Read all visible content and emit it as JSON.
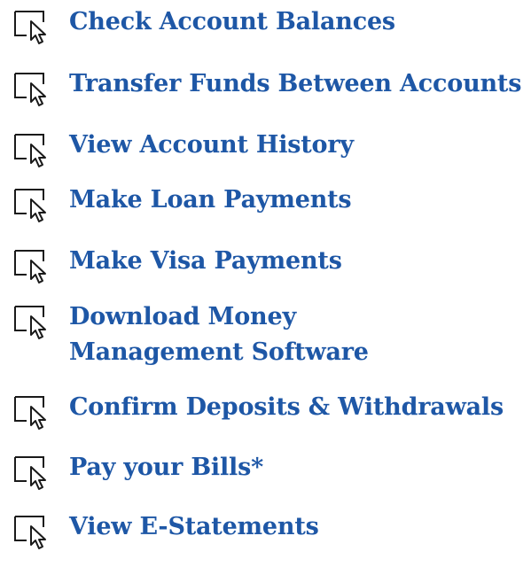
{
  "colors": {
    "link_text": "#1e57a6",
    "icon_stroke": "#1a1a1a",
    "background": "#ffffff"
  },
  "features": {
    "icon": "mouse-pointer-cursor-icon",
    "items": [
      {
        "label": "Check Account Balances"
      },
      {
        "label": "Transfer Funds Between Accounts"
      },
      {
        "label": "View Account History"
      },
      {
        "label": "Make Loan Payments"
      },
      {
        "label": "Make Visa Payments"
      },
      {
        "label": "Download Money Management Software"
      },
      {
        "label": "Confirm Deposits & Withdrawals"
      },
      {
        "label": "Pay your Bills*"
      },
      {
        "label": "View E-Statements"
      }
    ]
  }
}
